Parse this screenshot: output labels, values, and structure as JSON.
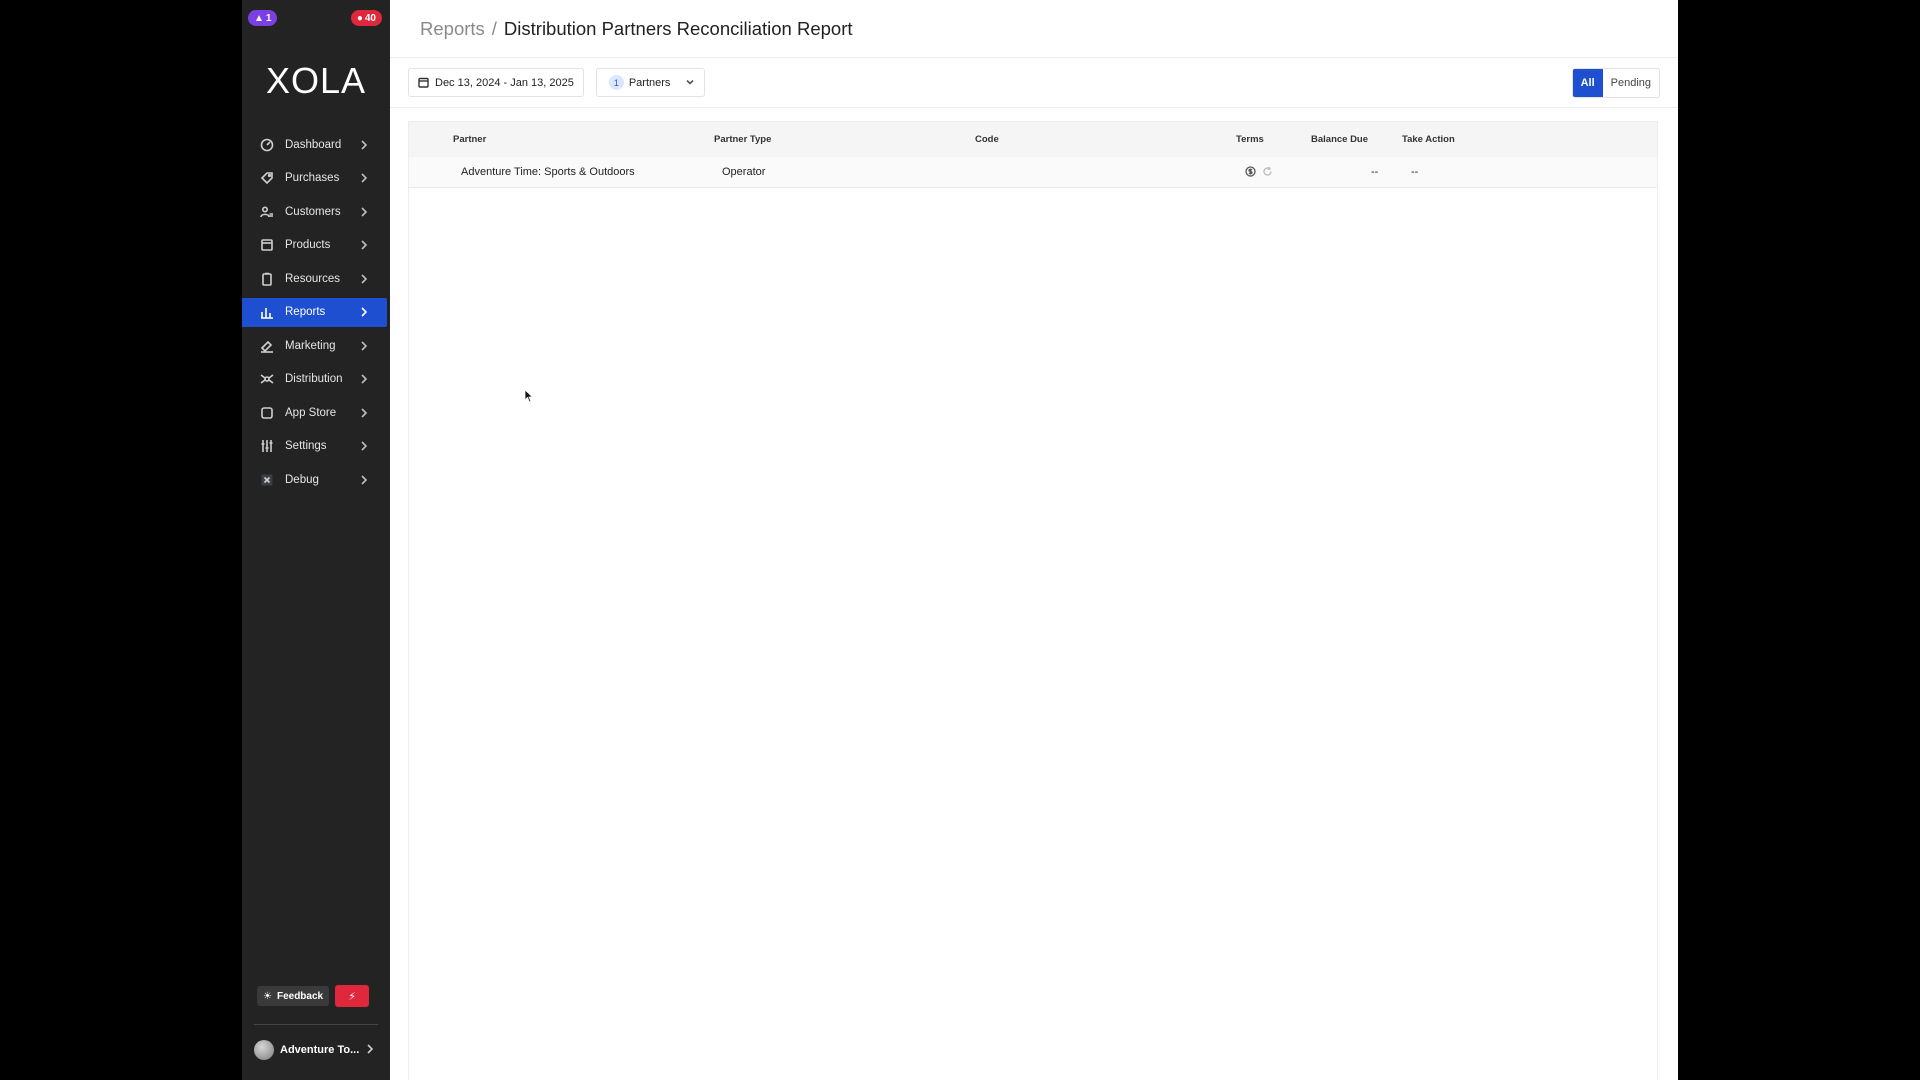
{
  "badges": {
    "left": "1",
    "right": "40"
  },
  "logo": "XOLA",
  "sidebar": {
    "items": [
      {
        "label": "Dashboard",
        "icon": "dashboard-icon"
      },
      {
        "label": "Purchases",
        "icon": "tag-icon"
      },
      {
        "label": "Customers",
        "icon": "users-icon"
      },
      {
        "label": "Products",
        "icon": "box-icon"
      },
      {
        "label": "Resources",
        "icon": "clipboard-icon"
      },
      {
        "label": "Reports",
        "icon": "bar-chart-icon",
        "active": true
      },
      {
        "label": "Marketing",
        "icon": "megaphone-icon"
      },
      {
        "label": "Distribution",
        "icon": "network-icon"
      },
      {
        "label": "App Store",
        "icon": "square-icon"
      },
      {
        "label": "Settings",
        "icon": "sliders-icon"
      },
      {
        "label": "Debug",
        "icon": "x-box-icon"
      }
    ],
    "feedback_label": "Feedback",
    "account_label": "Adventure To..."
  },
  "header": {
    "root": "Reports",
    "separator": "/",
    "title": "Distribution Partners Reconciliation Report"
  },
  "toolbar": {
    "date_range": "Dec 13, 2024 - Jan 13, 2025",
    "partners_count": "1",
    "partners_label": "Partners",
    "filter_all": "All",
    "filter_pending": "Pending"
  },
  "table": {
    "columns": [
      "Partner",
      "Partner Type",
      "Code",
      "Terms",
      "Balance Due",
      "Take Action"
    ],
    "rows": [
      {
        "partner": "Adventure Time: Sports & Outdoors",
        "type": "Operator",
        "code": "",
        "balance": "--",
        "action": "--"
      }
    ]
  },
  "colors": {
    "accent": "#1e4fd1",
    "sidebar": "#232323",
    "alert": "#e0283c"
  }
}
